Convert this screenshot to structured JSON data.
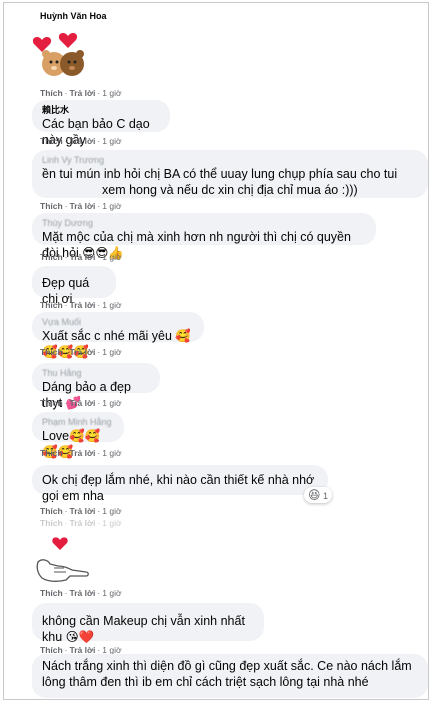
{
  "comments": [
    {
      "author": "Huỳnh Văn Hoa",
      "text": "",
      "like": "Thích",
      "reply": "Trả lời",
      "time": "1 giờ"
    },
    {
      "author": "賴比水",
      "text": "Các bạn bảo C dạo này gầy",
      "like": "Thích",
      "reply": "Trả lời",
      "time": "1 giờ"
    },
    {
      "author": "Linh Vy Trương",
      "text": "ền tui mún inb hỏi chị BA có thể uuay lung chụp phía sau cho tui xem hong và nếu dc xin chị địa chỉ mua áo :)))",
      "like": "Thích",
      "reply": "Trả lời",
      "time": "1 giờ"
    },
    {
      "author": "Thùy Dương",
      "text": "Mặt mộc của chị mà xinh hơn nh người thì chị có quyền đòi hỏi 😎😎👍",
      "like": "Thích",
      "reply": "Trả lời",
      "time": "1 giờ"
    },
    {
      "author": "",
      "text": "Đẹp quá chị ơi",
      "like": "Thích",
      "reply": "Trả lời",
      "time": "1 giờ"
    },
    {
      "author": "Vựa Muối",
      "text": "Xuất sắc c nhé mãi yêu 🥰🥰🥰🥰",
      "like": "Thích",
      "reply": "Trả lời",
      "time": "1 giờ"
    },
    {
      "author": "Thu Hằng",
      "text": "Dáng bảo a đẹp thyt 💕",
      "like": "Thích",
      "reply": "Trả lời",
      "time": "1 giờ"
    },
    {
      "author": "Phạm Minh Hằng",
      "text": "Love🥰🥰🥰🥰",
      "like": "Thích",
      "reply": "Trả lời",
      "time": "1 giờ"
    },
    {
      "author": "",
      "text": "Ok chị đẹp lắm nhé, khi nào cần thiết kế nhà nhớ gọi em nha",
      "like": "Thích",
      "reply": "Trả lời",
      "time": "1 giờ",
      "reaction_count": "1"
    },
    {
      "author": "",
      "text": "",
      "like": "Thích",
      "reply": "Trả lời",
      "time": "1 giờ"
    },
    {
      "author": "",
      "text": "",
      "like": "Thích",
      "reply": "Trả lời",
      "time": "1 giờ"
    },
    {
      "author": "",
      "text": "không cần Makeup chị vẫn xinh nhất khu 😘❤️",
      "like": "Thích",
      "reply": "Trả lời",
      "time": "1 giờ"
    },
    {
      "author": "",
      "text": "Nách trắng xinh thì diện đồ gì cũng đẹp xuất sắc. Ce nào nách lắm lông thâm đen thì ib em chỉ cách triệt sạch lông tại nhà nhé",
      "like": "",
      "reply": "",
      "time": ""
    }
  ],
  "colors": {
    "bubble": "#f0f2f5",
    "meta": "#65676b",
    "heart": "#e41e3f"
  }
}
